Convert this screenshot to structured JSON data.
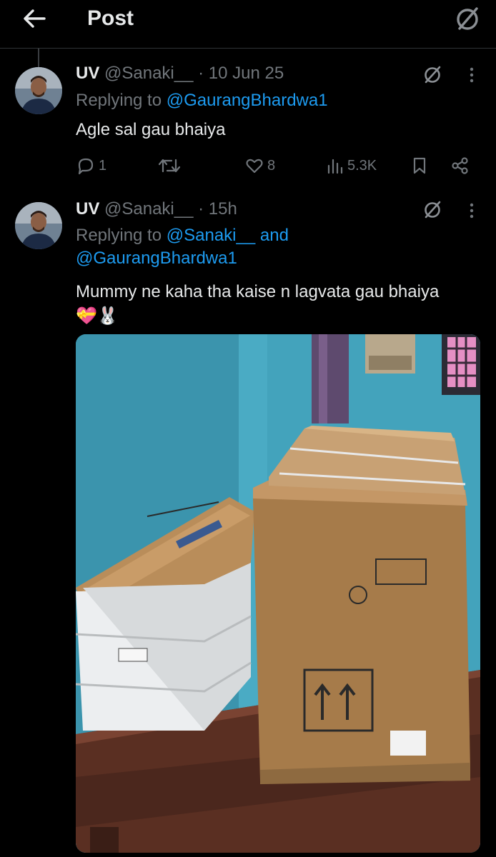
{
  "header": {
    "title": "Post",
    "back_icon": "arrow-left-icon",
    "grok_icon": "grok-icon"
  },
  "tweets": [
    {
      "name": "UV",
      "handle": "@Sanaki__",
      "time": "· 10 Jun 25",
      "replying_label": "Replying to",
      "replying_to": "@GaurangBhardwa1",
      "text": "Agle sal gau bhaiya",
      "actions": {
        "replies": "1",
        "reposts": "",
        "likes": "8",
        "views": "5.3K"
      }
    },
    {
      "name": "UV",
      "handle": "@Sanaki__",
      "time": "· 15h",
      "replying_label": "Replying to",
      "replying_to_1": "@Sanaki__",
      "and": "and",
      "replying_to_2": "@GaurangBhardwa1",
      "text": "Mummy ne kaha tha kaise n lagvata gau bhaiya 💝🐰",
      "media_description_icon": "photo-boxes"
    }
  ],
  "colors": {
    "background": "#000000",
    "text": "#e7e9ea",
    "muted": "#71767b",
    "accent": "#1d9bf0",
    "divider": "#2f3336"
  }
}
